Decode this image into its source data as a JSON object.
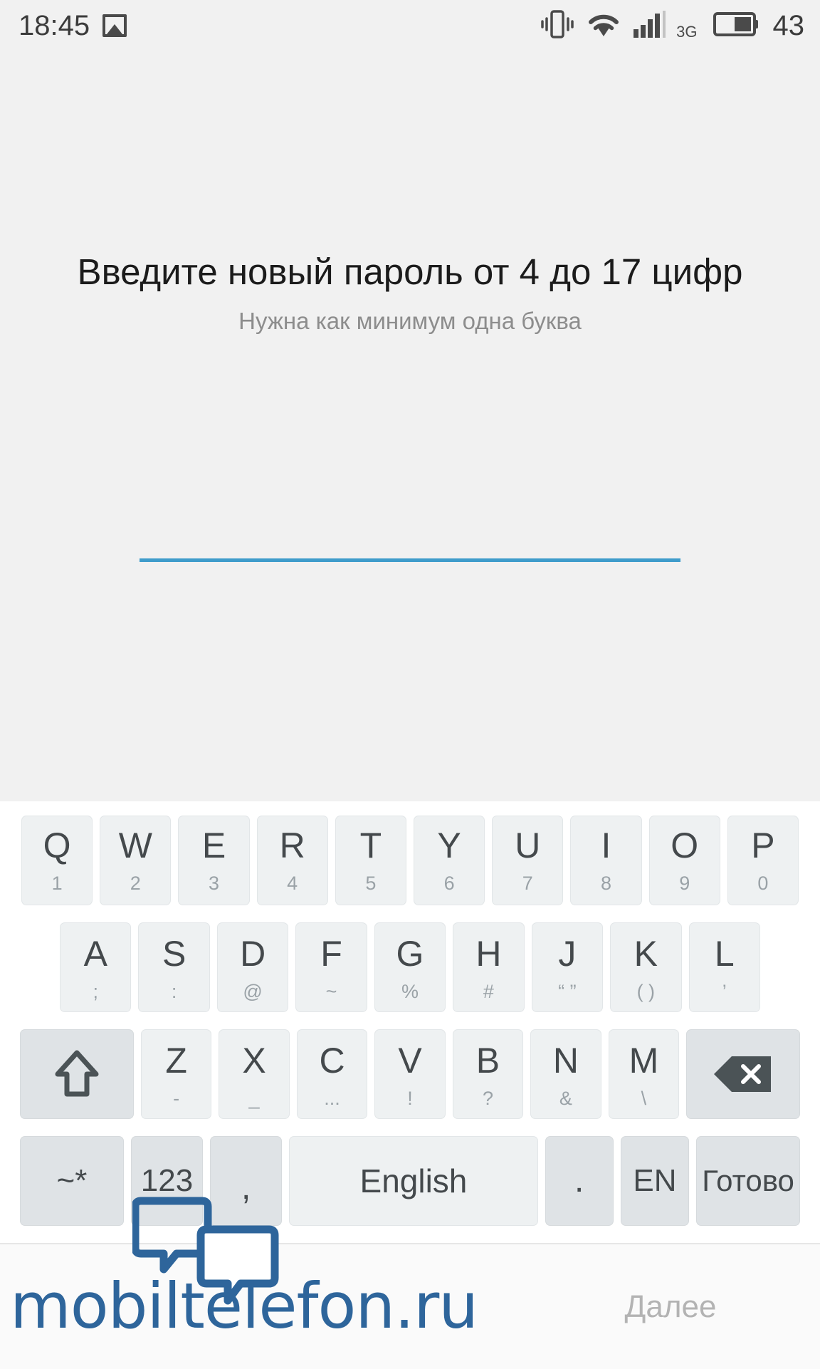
{
  "status_bar": {
    "time": "18:45",
    "battery_percent": "43",
    "icons": [
      "image-thumbnail-icon",
      "vibrate-icon",
      "wifi-icon",
      "signal-bars-icon",
      "3g-icon",
      "battery-icon"
    ],
    "network_label": "3G",
    "background_color": "#f1f1f1",
    "text_color": "#3b3b3b"
  },
  "content": {
    "title": "Введите новый пароль от 4 до 17 цифр",
    "subtitle": "Нужна как минимум одна буква",
    "password_field": {
      "value": "",
      "placeholder": "",
      "underline_color": "#3f9ccb"
    },
    "background_color": "#f1f1f1"
  },
  "keyboard": {
    "language_label": "English",
    "background_color": "#ffffff",
    "key_color": "#eef1f2",
    "modifier_key_color": "#dfe3e6",
    "row1": [
      {
        "main": "Q",
        "sub": "1"
      },
      {
        "main": "W",
        "sub": "2"
      },
      {
        "main": "E",
        "sub": "3"
      },
      {
        "main": "R",
        "sub": "4"
      },
      {
        "main": "T",
        "sub": "5"
      },
      {
        "main": "Y",
        "sub": "6"
      },
      {
        "main": "U",
        "sub": "7"
      },
      {
        "main": "I",
        "sub": "8"
      },
      {
        "main": "O",
        "sub": "9"
      },
      {
        "main": "P",
        "sub": "0"
      }
    ],
    "row2": [
      {
        "main": "A",
        "sub": ";"
      },
      {
        "main": "S",
        "sub": ":"
      },
      {
        "main": "D",
        "sub": "@"
      },
      {
        "main": "F",
        "sub": "~"
      },
      {
        "main": "G",
        "sub": "%"
      },
      {
        "main": "H",
        "sub": "#"
      },
      {
        "main": "J",
        "sub": "“ ”"
      },
      {
        "main": "K",
        "sub": "( )"
      },
      {
        "main": "L",
        "sub": "’"
      }
    ],
    "row3": [
      {
        "main": "Z",
        "sub": "-"
      },
      {
        "main": "X",
        "sub": "_"
      },
      {
        "main": "C",
        "sub": "..."
      },
      {
        "main": "V",
        "sub": "!"
      },
      {
        "main": "B",
        "sub": "?"
      },
      {
        "main": "N",
        "sub": "&"
      },
      {
        "main": "M",
        "sub": "\\"
      }
    ],
    "shift_key": "shift-icon",
    "backspace_key": "backspace-icon",
    "row4": {
      "symbols": "~*",
      "numbers": "123",
      "comma": ",",
      "space": "English",
      "period": ".",
      "language": "EN",
      "done": "Готово"
    }
  },
  "bottom_bar": {
    "next_label": "Далее",
    "next_color": "#b3b3b3",
    "background_color": "#fafafa"
  },
  "watermark": {
    "text": "mobiltelefon.ru",
    "color": "#2e659b"
  }
}
